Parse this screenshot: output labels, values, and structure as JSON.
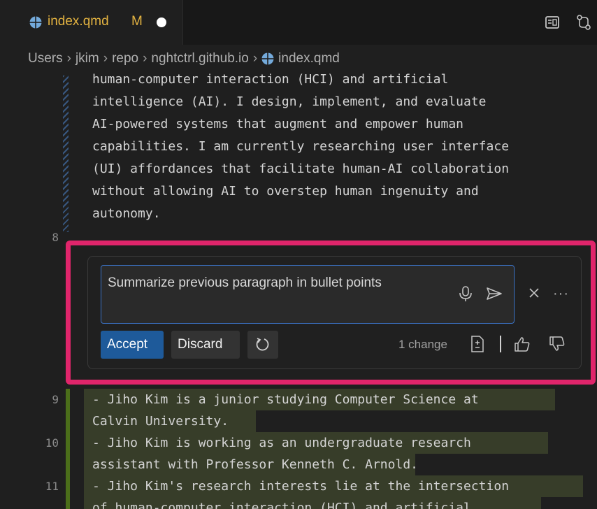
{
  "tab": {
    "title": "index.qmd",
    "status": "M"
  },
  "breadcrumb": {
    "items": [
      "Users",
      "jkim",
      "repo",
      "nghtctrl.github.io"
    ],
    "file": "index.qmd"
  },
  "editor": {
    "lines_before": [
      "human-computer interaction (HCI) and artificial",
      "intelligence (AI). I design, implement, and evaluate",
      "AI-powered systems that augment and empower human",
      "capabilities. I am currently researching user interface",
      "(UI) affordances that facilitate human-AI collaboration",
      "without allowing AI to overstep human ingenuity and",
      "autonomy."
    ],
    "line_8_number": "8",
    "added_lines": [
      {
        "num": "9",
        "text": "- Jiho Kim is a junior studying Computer Science at"
      },
      {
        "num": "",
        "text": "Calvin University."
      },
      {
        "num": "10",
        "text": "- Jiho Kim is working as an undergraduate research"
      },
      {
        "num": "",
        "text": "assistant with Professor Kenneth C. Arnold."
      },
      {
        "num": "11",
        "text": "- Jiho Kim's research interests lie at the intersection"
      },
      {
        "num": "",
        "text": "of human-computer interaction (HCI) and artificial"
      }
    ]
  },
  "inline_chat": {
    "input_value": "Summarize previous paragraph in bullet points",
    "accept_label": "Accept",
    "discard_label": "Discard",
    "change_count": "1 change",
    "more_label": "···"
  },
  "colors": {
    "highlight_border": "#e0256b",
    "accent_blue": "#1e5a9a",
    "modified": "#e3b341",
    "added_gutter": "#4b6e1a",
    "added_bg": "#373d29"
  },
  "icons": {
    "file": "quarto-globe-icon",
    "layout": "reader-view-icon",
    "compare": "compare-changes-icon",
    "mic": "microphone-icon",
    "send": "send-icon",
    "close": "close-icon",
    "regenerate": "rerun-icon",
    "diff": "diff-icon",
    "thumbs_up": "thumbs-up-icon",
    "thumbs_down": "thumbs-down-icon"
  }
}
